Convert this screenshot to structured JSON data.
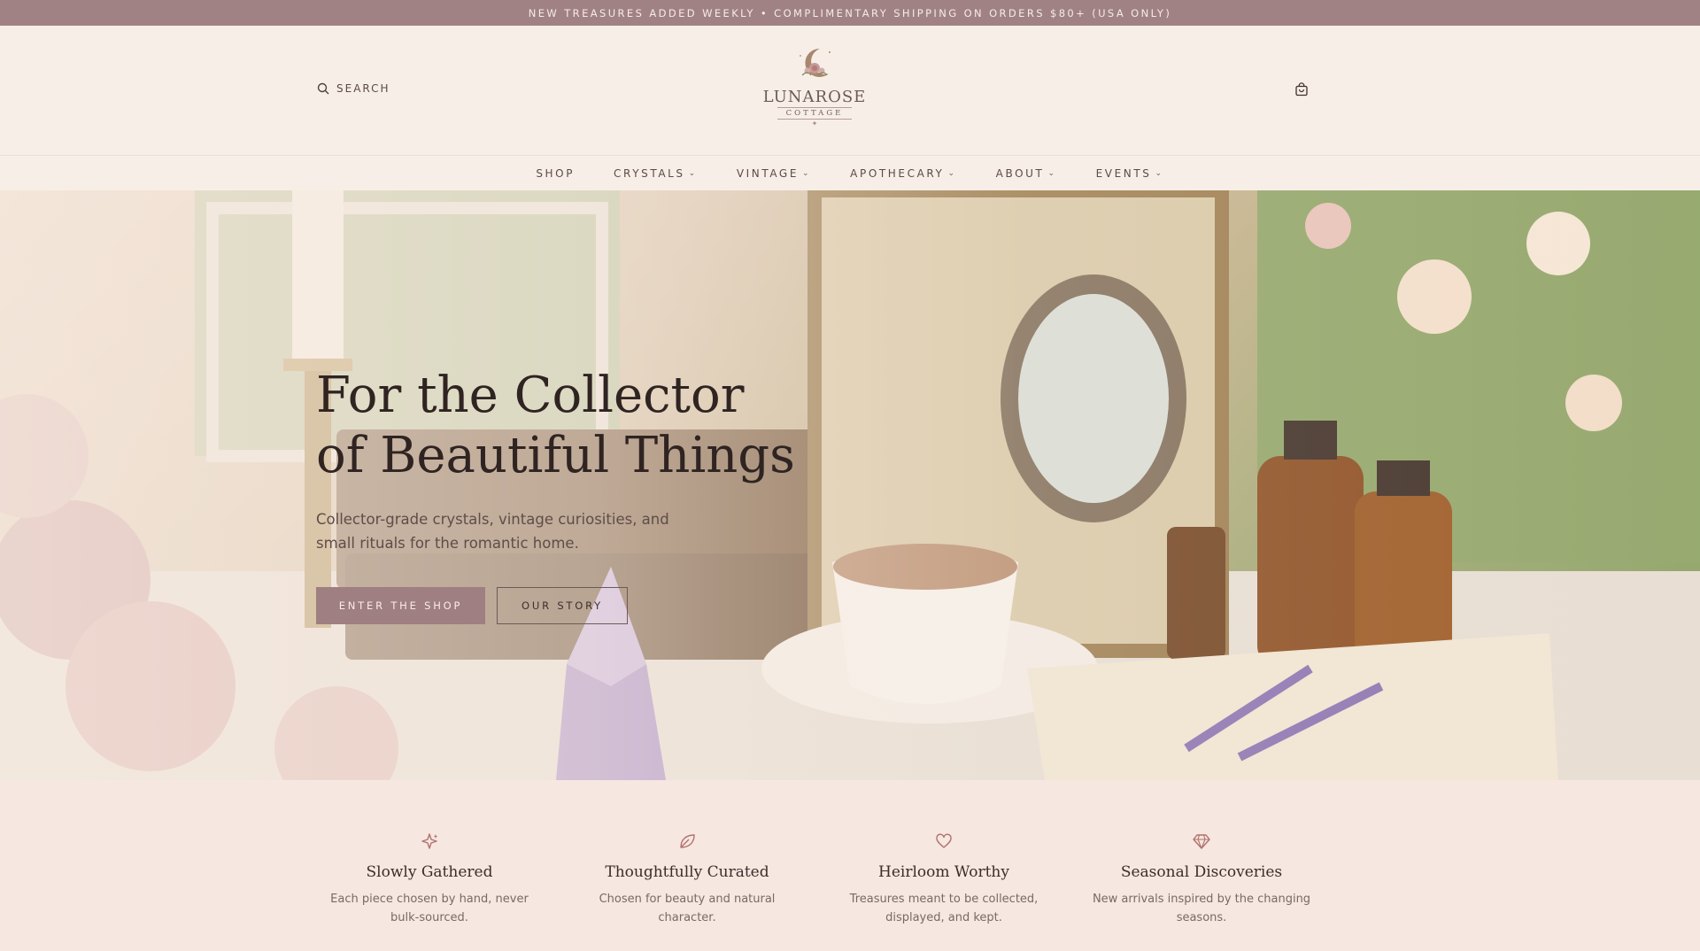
{
  "announcement": {
    "text": "NEW TREASURES ADDED WEEKLY • COMPLIMENTARY SHIPPING ON ORDERS $80+ (USA ONLY)"
  },
  "header": {
    "search_label": "SEARCH",
    "logo": {
      "name": "LUNAROSE",
      "sub": "COTTAGE",
      "star": "✦"
    },
    "cart_icon": "shopping-bag-icon"
  },
  "nav": {
    "items": [
      {
        "label": "SHOP",
        "dropdown": false
      },
      {
        "label": "CRYSTALS",
        "dropdown": true
      },
      {
        "label": "VINTAGE",
        "dropdown": true
      },
      {
        "label": "APOTHECARY",
        "dropdown": true
      },
      {
        "label": "ABOUT",
        "dropdown": true
      },
      {
        "label": "EVENTS",
        "dropdown": true
      }
    ],
    "chevron": "⌄"
  },
  "hero": {
    "title_line1": "For the Collector",
    "title_line2": "of Beautiful Things",
    "subtitle": "Collector-grade crystals, vintage curiosities, and small rituals for the romantic home.",
    "primary_cta": "ENTER THE SHOP",
    "secondary_cta": "OUR STORY"
  },
  "features": [
    {
      "icon": "sparkle-icon",
      "title": "Slowly Gathered",
      "text": "Each piece chosen by hand, never bulk-sourced."
    },
    {
      "icon": "leaf-icon",
      "title": "Thoughtfully Curated",
      "text": "Chosen for beauty and natural character."
    },
    {
      "icon": "heart-icon",
      "title": "Heirloom Worthy",
      "text": "Treasures meant to be collected, displayed, and kept."
    },
    {
      "icon": "gem-icon",
      "title": "Seasonal Discoveries",
      "text": "New arrivals inspired by the changing seasons."
    }
  ],
  "colors": {
    "announcement_bg": "#a08285",
    "accent": "#9f7f82",
    "icon": "#b1716d"
  }
}
